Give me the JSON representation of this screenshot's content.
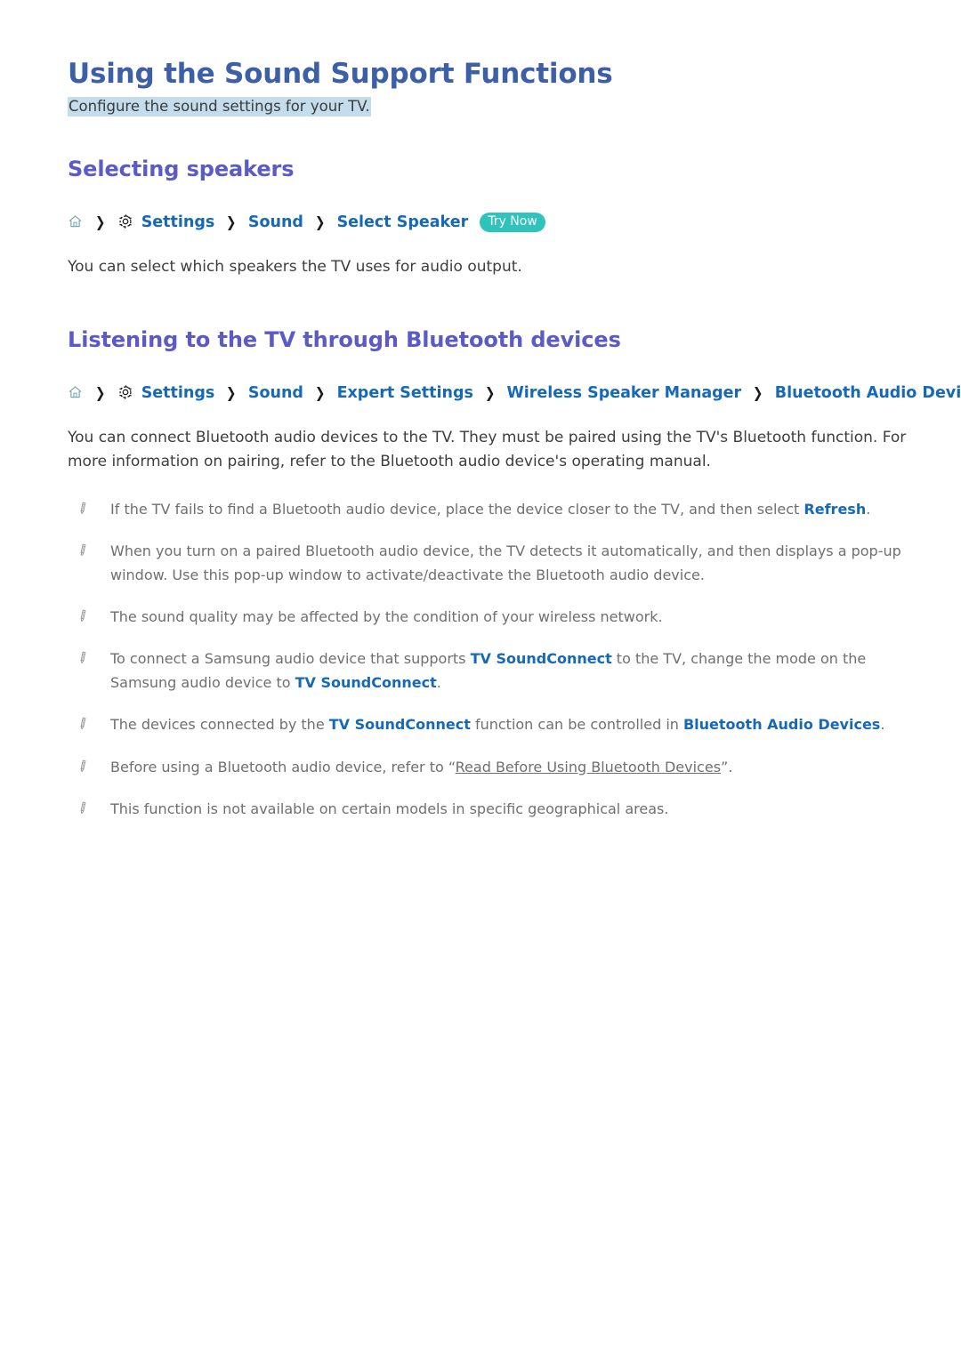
{
  "document": {
    "title": "Using the Sound Support Functions",
    "subtitle": "Configure the sound settings for your TV."
  },
  "sections": [
    {
      "heading": "Selecting speakers",
      "path": {
        "home_icon": "home-icon",
        "gear_icon": "gear-icon",
        "separator": "❯",
        "crumbs": [
          "Settings",
          "Sound",
          "Select Speaker"
        ],
        "badge": "Try Now"
      },
      "body": "You can select which speakers the TV uses for audio output."
    },
    {
      "heading": "Listening to the TV through Bluetooth devices",
      "path": {
        "home_icon": "home-icon",
        "gear_icon": "gear-icon",
        "separator": "❯",
        "crumbs": [
          "Settings",
          "Sound",
          "Expert Settings",
          "Wireless Speaker Manager",
          "Bluetooth Audio Devices"
        ]
      },
      "body_line1": "You can connect Bluetooth audio devices to the TV. They must be paired using the TV's Bluetooth function.",
      "body_line2": "For more information on pairing, refer to the Bluetooth audio device's operating manual."
    }
  ],
  "notes": [
    {
      "icon": "pencil-icon",
      "segments": [
        {
          "text": "If the TV fails to find a Bluetooth audio device, place the device closer to the TV, and then select ",
          "style": "normal"
        },
        {
          "text": "Refresh",
          "style": "link-strong"
        },
        {
          "text": ".",
          "style": "normal"
        }
      ]
    },
    {
      "icon": "pencil-icon",
      "segments": [
        {
          "text": "When you turn on a paired Bluetooth audio device, the TV detects it automatically, and then displays a pop-up window. Use this pop-up window to activate/deactivate the Bluetooth audio device.",
          "style": "normal"
        }
      ]
    },
    {
      "icon": "pencil-icon",
      "segments": [
        {
          "text": "The sound quality may be affected by the condition of your wireless network.",
          "style": "normal"
        }
      ]
    },
    {
      "icon": "pencil-icon",
      "segments": [
        {
          "text": "To connect a Samsung audio device that supports ",
          "style": "normal"
        },
        {
          "text": "TV SoundConnect",
          "style": "link-strong"
        },
        {
          "text": " to the TV, change the mode on the Samsung audio device to ",
          "style": "normal"
        },
        {
          "text": "TV SoundConnect",
          "style": "link-strong"
        },
        {
          "text": ".",
          "style": "normal"
        }
      ]
    },
    {
      "icon": "pencil-icon",
      "segments": [
        {
          "text": "The devices connected by the ",
          "style": "normal"
        },
        {
          "text": "TV SoundConnect",
          "style": "link-strong"
        },
        {
          "text": " function can be controlled in ",
          "style": "normal"
        },
        {
          "text": "Bluetooth Audio Devices",
          "style": "link-strong"
        },
        {
          "text": ".",
          "style": "normal"
        }
      ]
    },
    {
      "icon": "pencil-icon",
      "segments": [
        {
          "text": "Before using a Bluetooth audio device, refer to “",
          "style": "normal"
        },
        {
          "text": "Read Before Using Bluetooth Devices",
          "style": "underlined"
        },
        {
          "text": "”.",
          "style": "normal"
        }
      ]
    },
    {
      "icon": "pencil-icon",
      "segments": [
        {
          "text": "This function is not available on certain models in specific geographical areas.",
          "style": "normal"
        }
      ]
    }
  ],
  "colors": {
    "title": "#3c5fa8",
    "heading": "#5a5ac8",
    "link": "#1668b8",
    "badge_bg": "#2ec4bb",
    "highlight_bg": "#c3dded",
    "body_text": "#3d3d3d",
    "note_text": "#6f6f6f"
  }
}
